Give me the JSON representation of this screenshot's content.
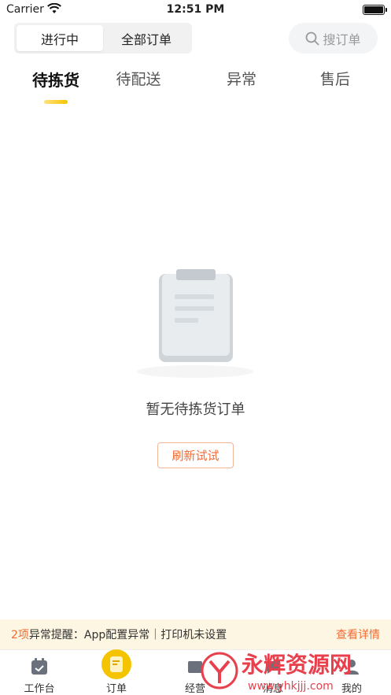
{
  "status_bar": {
    "carrier": "Carrier",
    "time": "12:51 PM"
  },
  "segment": {
    "options": [
      "进行中",
      "全部订单"
    ],
    "selected": "进行中"
  },
  "search": {
    "label": "搜订单"
  },
  "tabs": [
    "待拣货",
    "待配送",
    "异常",
    "售后"
  ],
  "active_tab": "待拣货",
  "empty_state": {
    "message": "暂无待拣货订单",
    "refresh_label": "刷新试试"
  },
  "notice": {
    "count": "2项",
    "text": "异常提醒：App配置异常｜打印机未设置",
    "detail_label": "查看详情"
  },
  "tabbar": [
    "工作台",
    "订单",
    "经营",
    "消息",
    "我的"
  ],
  "active_tabbar": "订单",
  "watermark": {
    "brand": "永辉资源网",
    "url": "www.yhkjjj.com"
  },
  "colors": {
    "accent": "#f26b34",
    "indicator": "#f5c400",
    "notice_bg": "#fdf6e2"
  }
}
